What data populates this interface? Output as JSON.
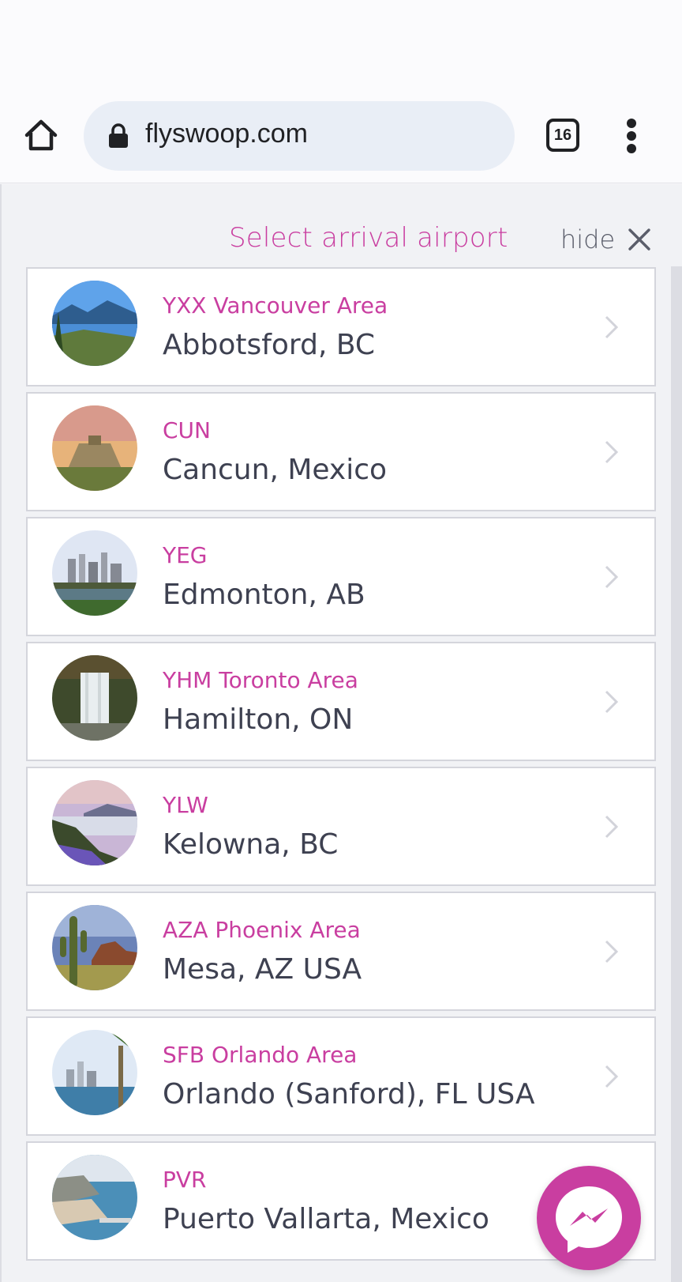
{
  "browser": {
    "url": "flyswoop.com",
    "tab_count": "16"
  },
  "sheet": {
    "title": "Select arrival airport",
    "hide_label": "hide"
  },
  "airports": [
    {
      "code": "YXX Vancouver Area",
      "city": "Abbotsford, BC"
    },
    {
      "code": "CUN",
      "city": "Cancun, Mexico"
    },
    {
      "code": "YEG",
      "city": "Edmonton, AB"
    },
    {
      "code": "YHM Toronto Area",
      "city": "Hamilton, ON"
    },
    {
      "code": "YLW",
      "city": "Kelowna, BC"
    },
    {
      "code": "AZA Phoenix Area",
      "city": "Mesa, AZ USA"
    },
    {
      "code": "SFB Orlando Area",
      "city": "Orlando (Sanford), FL USA"
    },
    {
      "code": "PVR",
      "city": "Puerto Vallarta, Mexico"
    }
  ],
  "colors": {
    "accent": "#c93ea0",
    "text_dark": "#3e4151",
    "sheet_bg": "#f1f2f5"
  }
}
